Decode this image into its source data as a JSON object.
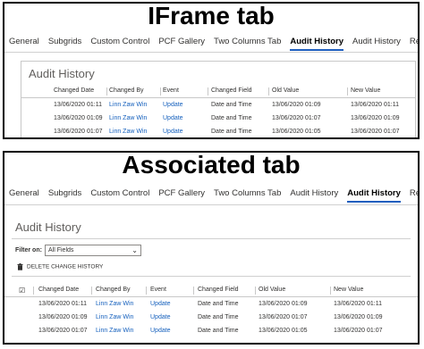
{
  "iframe_panel": {
    "title": "IFrame tab",
    "tabs": [
      "General",
      "Subgrids",
      "Custom Control",
      "PCF Gallery",
      "Two Columns Tab",
      "Audit History",
      "Audit History",
      "Related"
    ],
    "active_tab": 5,
    "section_title": "Audit History",
    "columns": [
      "Changed Date",
      "Changed By",
      "Event",
      "Changed Field",
      "Old Value",
      "New Value"
    ],
    "rows": [
      {
        "date": "13/06/2020 01:11",
        "by": "Linn Zaw Win",
        "event": "Update",
        "field": "Date and Time",
        "old": "13/06/2020 01:09",
        "new": "13/06/2020 01:11"
      },
      {
        "date": "13/06/2020 01:09",
        "by": "Linn Zaw Win",
        "event": "Update",
        "field": "Date and Time",
        "old": "13/06/2020 01:07",
        "new": "13/06/2020 01:09"
      },
      {
        "date": "13/06/2020 01:07",
        "by": "Linn Zaw Win",
        "event": "Update",
        "field": "Date and Time",
        "old": "13/06/2020 01:05",
        "new": "13/06/2020 01:07"
      }
    ]
  },
  "associated_panel": {
    "title": "Associated tab",
    "tabs": [
      "General",
      "Subgrids",
      "Custom Control",
      "PCF Gallery",
      "Two Columns Tab",
      "Audit History",
      "Audit History",
      "Related"
    ],
    "active_tab": 6,
    "section_title": "Audit History",
    "filter_label": "Filter on:",
    "filter_value": "All Fields",
    "delete_label": "DELETE CHANGE HISTORY",
    "columns": [
      "Changed Date",
      "Changed By",
      "Event",
      "Changed Field",
      "Old Value",
      "New Value"
    ],
    "rows": [
      {
        "date": "13/06/2020 01:11",
        "by": "Linn Zaw Win",
        "event": "Update",
        "field": "Date and Time",
        "old": "13/06/2020 01:09",
        "new": "13/06/2020 01:11"
      },
      {
        "date": "13/06/2020 01:09",
        "by": "Linn Zaw Win",
        "event": "Update",
        "field": "Date and Time",
        "old": "13/06/2020 01:07",
        "new": "13/06/2020 01:09"
      },
      {
        "date": "13/06/2020 01:07",
        "by": "Linn Zaw Win",
        "event": "Update",
        "field": "Date and Time",
        "old": "13/06/2020 01:05",
        "new": "13/06/2020 01:07"
      }
    ]
  },
  "colors": {
    "link": "#1560bd",
    "tab_underline": "#1f5fbf",
    "border": "#000000"
  }
}
